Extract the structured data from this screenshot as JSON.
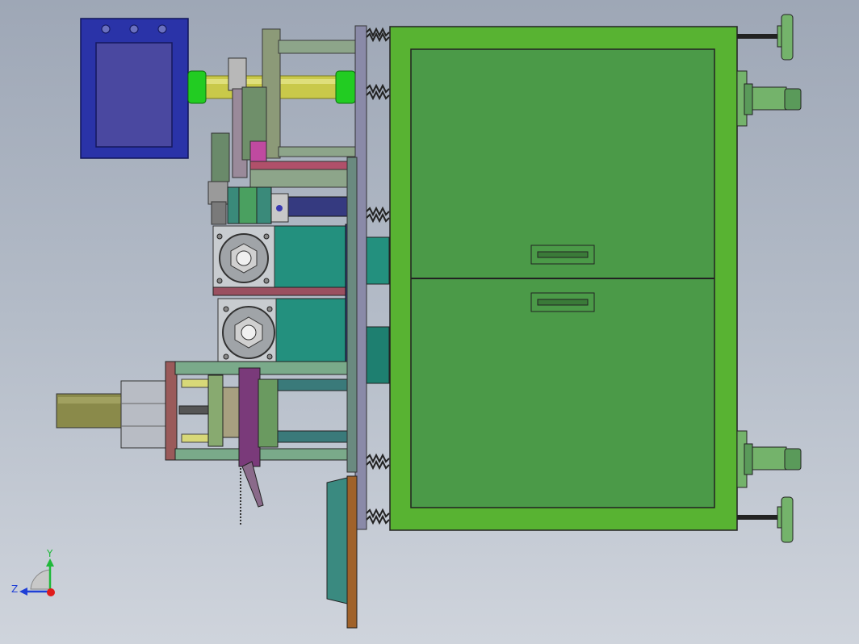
{
  "viewport": {
    "background_top": "#9ea7b6",
    "background_bottom": "#cfd4dc"
  },
  "triad": {
    "y_label": "Y",
    "z_label": "Z",
    "y_color": "#1fb83a",
    "z_color": "#1f3fd6",
    "x_color": "#e01b1b"
  },
  "model": {
    "cabinet_color": "#58b332",
    "drawer_color": "#4b9a48",
    "control_box_color": "#2a33a8",
    "motor_body_color": "#23907e",
    "motor_color": "#8a8a4a",
    "shaft_color": "#c9c94a",
    "shaft_end_color": "#22cc22",
    "frame_color": "#5a7aa0",
    "foot_color": "#74b36b"
  }
}
